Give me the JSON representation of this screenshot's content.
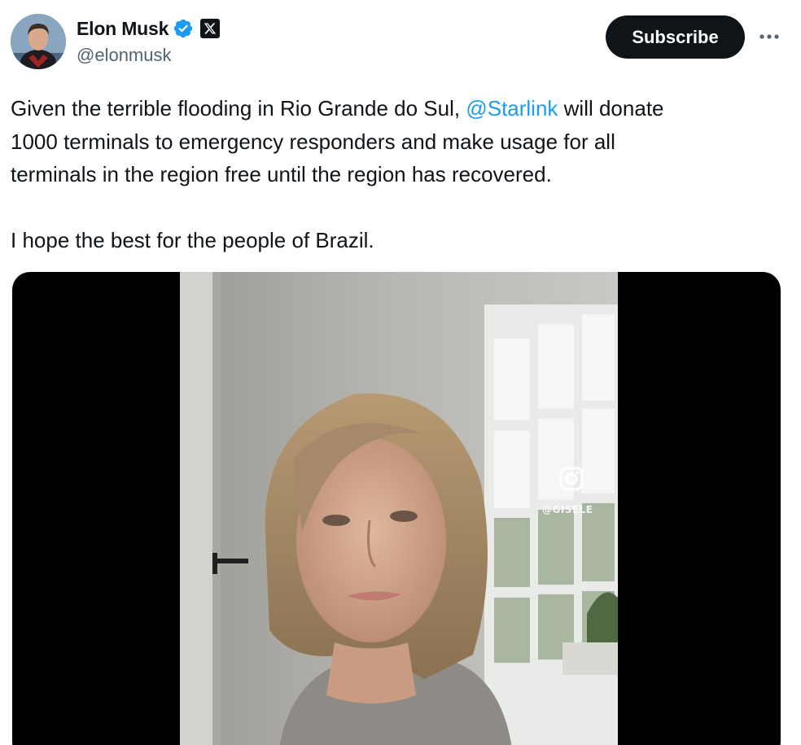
{
  "author": {
    "display_name": "Elon Musk",
    "handle": "@elonmusk",
    "avatar_icon": "avatar-photo",
    "verified_icon": "verified-badge-icon",
    "affiliate_icon": "x-logo-icon"
  },
  "actions": {
    "subscribe_label": "Subscribe",
    "more_icon": "more-dots-icon"
  },
  "tweet": {
    "line1_before": "Given the terrible flooding in Rio Grande do Sul, ",
    "mention": "@Starlink",
    "line1_after": " will donate",
    "line2": "1000 terminals to emergency responders and make usage for all",
    "line3": "terminals in the region free until the region has recovered.",
    "line4": "I hope the best for the people of Brazil."
  },
  "media": {
    "type": "video",
    "watermark_icon": "instagram-icon",
    "watermark_text": "@GISELE"
  },
  "colors": {
    "text": "#0f1419",
    "secondary": "#536471",
    "link": "#1d9bf0",
    "verified": "#1d9bf0",
    "button": "#0f1419"
  }
}
